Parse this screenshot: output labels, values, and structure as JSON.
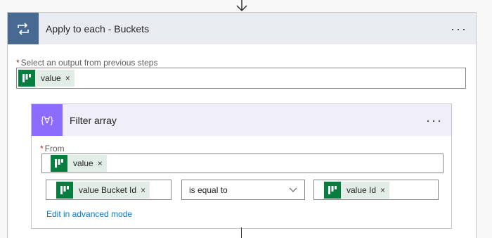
{
  "outer": {
    "title": "Apply to each - Buckets",
    "more_label": "···",
    "select_label": "Select an output from previous steps",
    "required_mark": "*",
    "token": {
      "label": "value",
      "close": "×"
    }
  },
  "inner": {
    "title": "Filter array",
    "more_label": "···",
    "icon_text": "{∀}",
    "from_label": "From",
    "required_mark": "*",
    "from_token": {
      "label": "value",
      "close": "×"
    },
    "condition": {
      "left_token": {
        "label": "value Bucket Id",
        "close": "×"
      },
      "operator": "is equal to",
      "right_token": {
        "label": "value Id",
        "close": "×"
      }
    },
    "advanced_link": "Edit in advanced mode"
  },
  "colors": {
    "loop_accent": "#486991",
    "filter_accent": "#8c6cff",
    "planner_green": "#077d3f",
    "link": "#0078d4"
  }
}
